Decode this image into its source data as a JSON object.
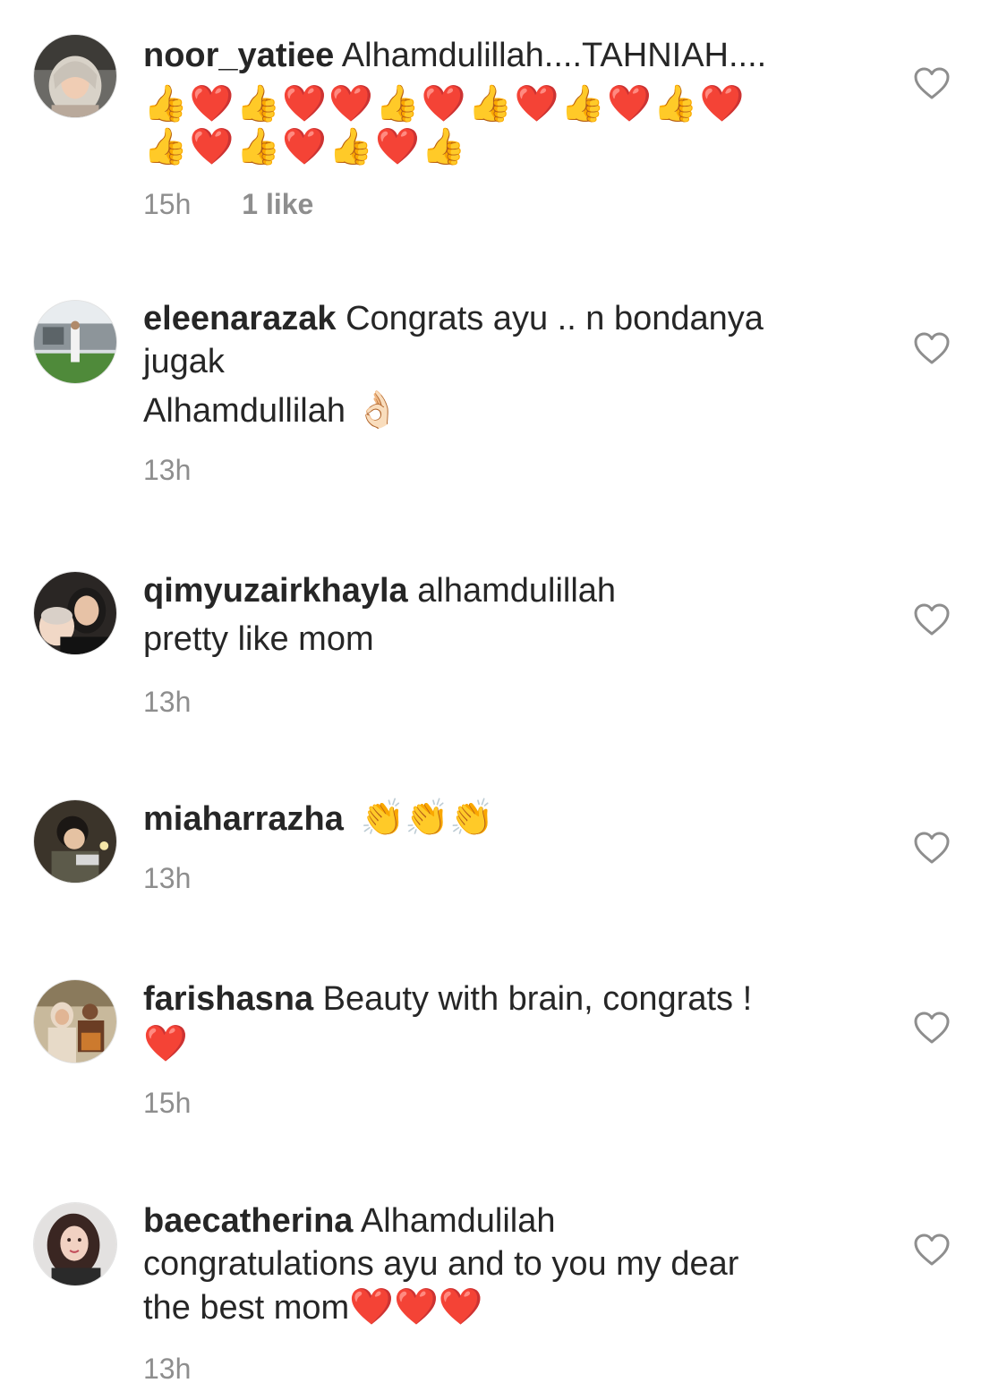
{
  "comments": [
    {
      "username": "noor_yatiee",
      "text": "Alhamdulillah....TAHNIAH....",
      "emoji_line1": "👍❤️👍❤️❤️👍❤️👍❤️👍❤️👍❤️",
      "emoji_line2": "👍❤️👍❤️👍❤️👍",
      "time": "15h",
      "likes": "1 like"
    },
    {
      "username": "eleenarazak",
      "text": "Congrats ayu .. n bondanya",
      "text_line2": "jugak",
      "text_line3": "Alhamdullilah",
      "emoji": "👌🏻",
      "time": "13h"
    },
    {
      "username": "qimyuzairkhayla",
      "text": "alhamdulillah",
      "text_line2": "pretty like mom",
      "time": "13h"
    },
    {
      "username": "miaharrazha",
      "emoji": "👏👏👏",
      "time": "13h"
    },
    {
      "username": "farishasna",
      "text": "Beauty with brain, congrats !",
      "emoji": "❤️",
      "time": "15h"
    },
    {
      "username": "baecatherina",
      "text": "Alhamdulilah",
      "text_line2": "congratulations ayu and to you my dear",
      "text_line3": "the best mom",
      "emoji": "❤️❤️❤️",
      "time": "13h"
    }
  ],
  "icons": {
    "like": "heart-outline-icon"
  },
  "colors": {
    "text": "#262626",
    "meta": "#8e8e8e",
    "icon": "#8e8e8e"
  }
}
